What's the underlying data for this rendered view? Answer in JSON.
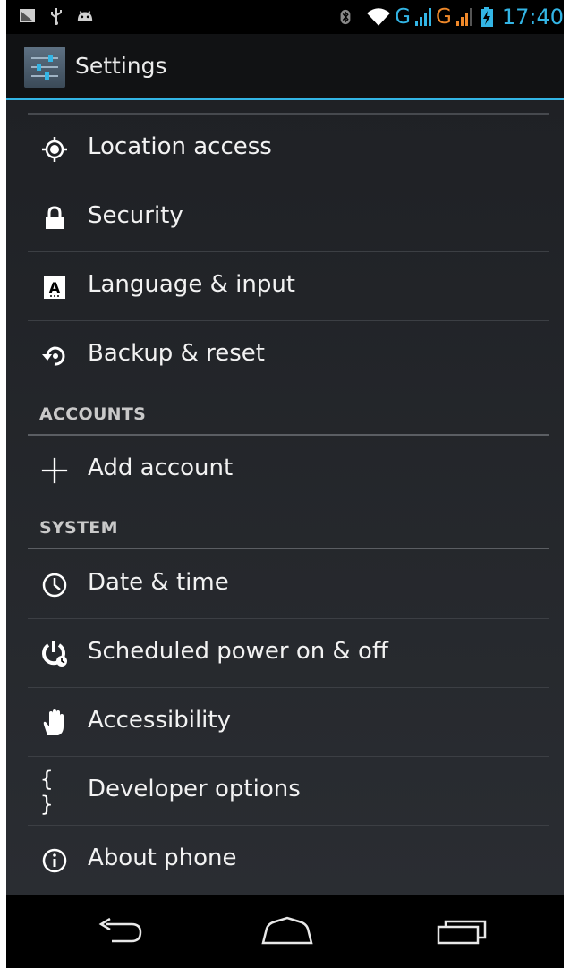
{
  "status_bar": {
    "left_icons": [
      "notification-icon",
      "usb-icon",
      "android-icon"
    ],
    "right_icons": [
      "bluetooth-icon",
      "wifi-icon",
      "signal-icon",
      "battery-charging-icon"
    ],
    "network_1": "G",
    "network_2": "G",
    "time": "17:40",
    "accent_color": "#33b5e5",
    "network_2_color": "#f0892a"
  },
  "action_bar": {
    "icon": "settings-app-icon",
    "title": "Settings"
  },
  "list": {
    "personal_items": [
      {
        "icon": "location-icon",
        "label": "Location access"
      },
      {
        "icon": "lock-icon",
        "label": "Security"
      },
      {
        "icon": "language-icon",
        "label": "Language & input"
      },
      {
        "icon": "backup-icon",
        "label": "Backup & reset"
      }
    ],
    "accounts_header": "ACCOUNTS",
    "accounts_items": [
      {
        "icon": "add-icon",
        "label": "Add account"
      }
    ],
    "system_header": "SYSTEM",
    "system_items": [
      {
        "icon": "clock-icon",
        "label": "Date & time"
      },
      {
        "icon": "power-schedule-icon",
        "label": "Scheduled power on & off"
      },
      {
        "icon": "hand-icon",
        "label": "Accessibility"
      },
      {
        "icon": "braces-icon",
        "label": "Developer options"
      },
      {
        "icon": "info-icon",
        "label": "About phone"
      }
    ]
  },
  "nav_bar": {
    "buttons": [
      "back-icon",
      "home-icon",
      "recents-icon"
    ]
  }
}
